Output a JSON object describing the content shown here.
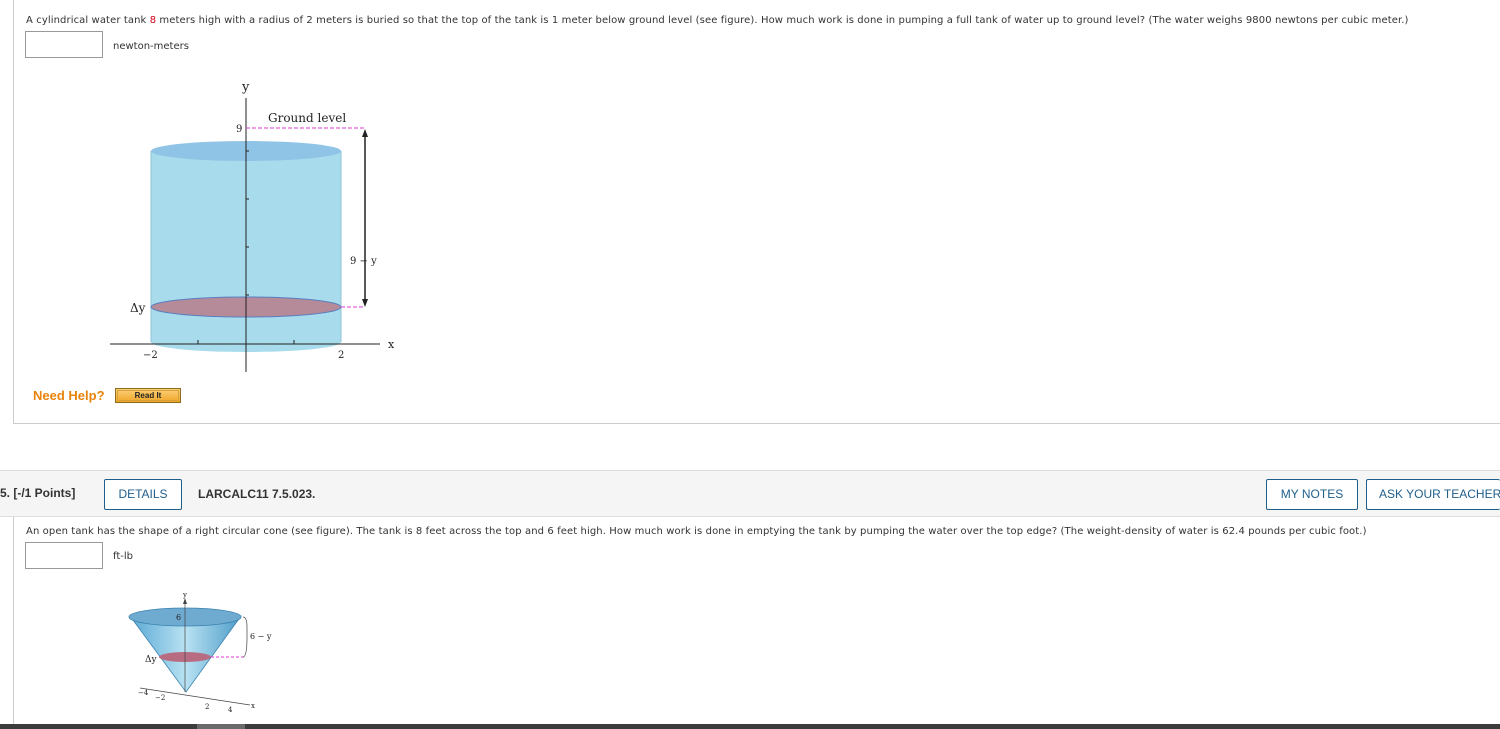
{
  "q4": {
    "text_before": "A cylindrical water tank ",
    "height_value": "8",
    "text_after": " meters high with a radius of 2 meters is buried so that the top of the tank is 1 meter below ground level (see figure). How much work is done in pumping a full tank of water up to ground level? (The water weighs 9800 newtons per cubic meter.)",
    "answer_value": "",
    "unit": "newton-meters",
    "figure": {
      "y_axis_label": "y",
      "x_axis_label": "x",
      "ground_label": "Ground level",
      "tick_9": "9",
      "dist_label": "9 − y",
      "dy_label": "Δy",
      "tick_neg2": "−2",
      "tick_2": "2"
    },
    "need_help": "Need Help?",
    "read_it": "Read It"
  },
  "q5": {
    "number": "5.  [-/1 Points]",
    "details_button": "DETAILS",
    "code": "LARCALC11 7.5.023.",
    "my_notes_button": "MY NOTES",
    "ask_teacher_button": "ASK YOUR TEACHER",
    "text": "An open tank has the shape of a right circular cone (see figure). The tank is 8 feet across the top and 6 feet high. How much work is done in emptying the tank by pumping the water over the top edge? (The weight-density of water is 62.4 pounds per cubic foot.)",
    "answer_value": "",
    "unit": "ft-lb",
    "figure": {
      "y_label": "y",
      "tick_6": "6",
      "dist_label": "6 − y",
      "dy_label": "Δy",
      "tick_neg4": "−4",
      "tick_neg2": "−2",
      "tick_2": "2",
      "tick_4": "4",
      "x_label": "x"
    }
  },
  "colors": {
    "water": "#a8dcec",
    "slice": "#b58a99",
    "guide": "#e03ad6",
    "accent": "#1f5f8b",
    "help": "#e8830c"
  }
}
